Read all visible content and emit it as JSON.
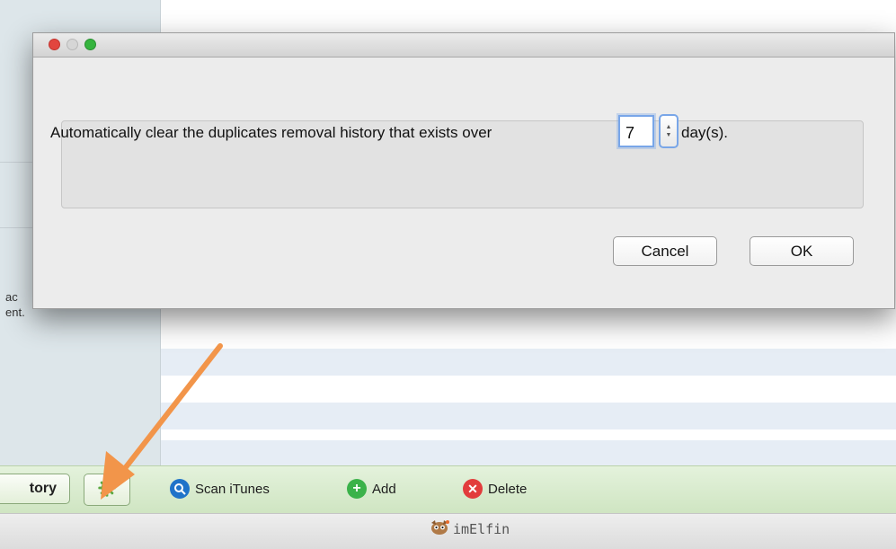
{
  "sidebar": {
    "text_line1": "ac",
    "text_line2": "ent."
  },
  "toolbar": {
    "history_label": "tory",
    "gear_icon": "gear-icon",
    "scan_label": "Scan iTunes",
    "add_label": "Add",
    "delete_label": "Delete",
    "colors": {
      "bar": "#d6ead0",
      "scan": "#1f73c9",
      "add": "#3bb24a",
      "delete": "#e23c3c",
      "gear": "#5aa841"
    }
  },
  "status": {
    "brand": "imElfin"
  },
  "dialog": {
    "message": "Automatically clear the duplicates removal history that exists over",
    "days_value": "7",
    "unit": "day(s).",
    "cancel_label": "Cancel",
    "ok_label": "OK",
    "traffic_lights": [
      "#e2463f",
      "#d6d6d6",
      "#35b43e"
    ]
  },
  "annotation": {
    "arrow_color": "#f2954a"
  }
}
